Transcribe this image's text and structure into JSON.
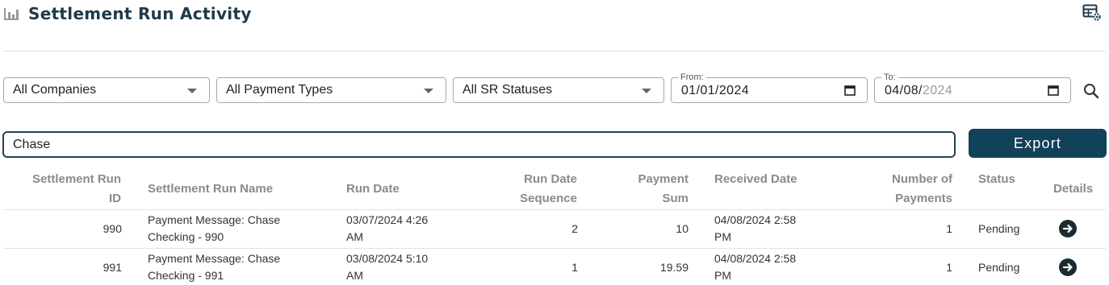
{
  "header": {
    "title": "Settlement Run Activity"
  },
  "filters": {
    "company": "All Companies",
    "payment_type": "All Payment Types",
    "sr_status": "All SR Statuses",
    "from_label": "From:",
    "from_value": "01/01/2024",
    "to_label": "To:",
    "to_value_entered": "04/08/",
    "to_value_placeholder": "2024"
  },
  "search": {
    "value": "Chase"
  },
  "toolbar": {
    "export_label": "Export"
  },
  "table": {
    "columns": {
      "id_line1": "Settlement Run",
      "id_line2": "ID",
      "name": "Settlement Run Name",
      "run_date": "Run Date",
      "seq_line1": "Run Date",
      "seq_line2": "Sequence",
      "sum_line1": "Payment",
      "sum_line2": "Sum",
      "received": "Received Date",
      "num_line1": "Number of",
      "num_line2": "Payments",
      "status": "Status",
      "details": "Details"
    },
    "rows": [
      {
        "id": "990",
        "name_line1": "Payment Message: Chase",
        "name_line2": "Checking - 990",
        "run_line1": "03/07/2024 4:26",
        "run_line2": "AM",
        "sequence": "2",
        "sum": "10",
        "recv_line1": "04/08/2024 2:58",
        "recv_line2": "PM",
        "count": "1",
        "status": "Pending"
      },
      {
        "id": "991",
        "name_line1": "Payment Message: Chase",
        "name_line2": "Checking - 991",
        "run_line1": "03/08/2024 5:10",
        "run_line2": "AM",
        "sequence": "1",
        "sum": "19.59",
        "recv_line1": "04/08/2024 2:58",
        "recv_line2": "PM",
        "count": "1",
        "status": "Pending"
      }
    ]
  },
  "icons": {
    "title": "bar-chart-icon",
    "settings": "table-settings-icon",
    "search": "search-icon",
    "details": "arrow-right-circle-icon"
  },
  "colors": {
    "title": "#1e3a4a",
    "export_button": "#11425a",
    "search_border": "#1c4456"
  }
}
